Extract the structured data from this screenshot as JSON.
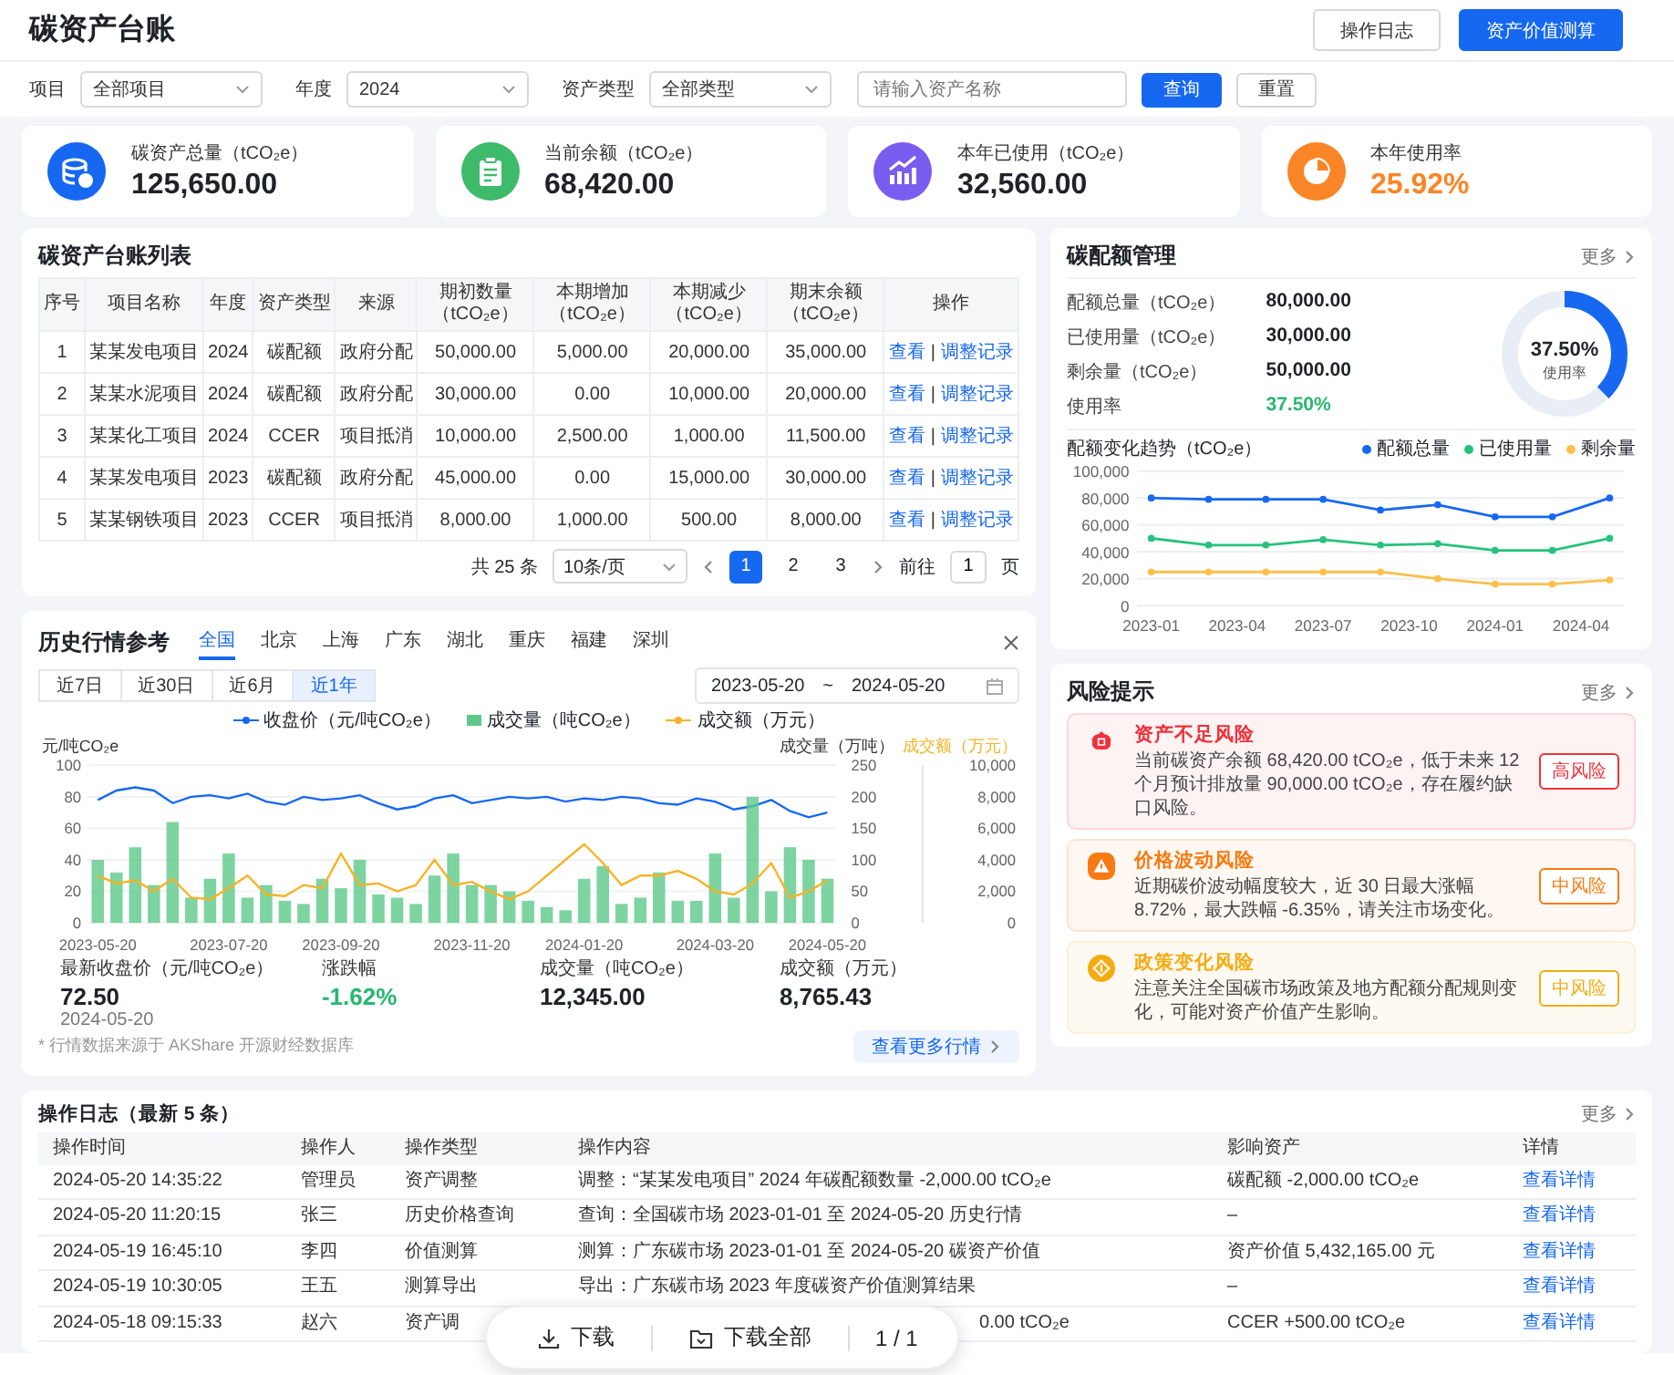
{
  "header": {
    "title": "碳资产台账",
    "buttons": [
      {
        "label": "操作日志",
        "primary": false
      },
      {
        "label": "资产价值测算",
        "primary": true
      }
    ]
  },
  "filters": {
    "selects": [
      {
        "label": "项目",
        "value": "全部项目"
      },
      {
        "label": "年度",
        "value": "2024"
      },
      {
        "label": "资产类型",
        "value": "全部类型"
      }
    ],
    "search": {
      "placeholder": "请输入资产名称"
    },
    "buttons": [
      {
        "label": "查询",
        "primary": true
      },
      {
        "label": "重置",
        "primary": false
      }
    ]
  },
  "kpis": [
    {
      "kind": "database",
      "label": "碳资产总量（tCO₂e）",
      "value": "125,650.00",
      "color": "#1668f0",
      "highlight": false
    },
    {
      "kind": "clipboard",
      "label": "当前余额（tCO₂e）",
      "value": "68,420.00",
      "color": "#3dba6a",
      "highlight": false
    },
    {
      "kind": "trend",
      "label": "本年已使用（tCO₂e）",
      "value": "32,560.00",
      "color": "#7b5cf0",
      "highlight": false
    },
    {
      "kind": "pie",
      "label": "本年使用率",
      "value": "25.92%",
      "color": "#fa8526",
      "highlight": true
    }
  ],
  "ledger": {
    "title": "碳资产台账列表",
    "columns": [
      "序号",
      "项目名称",
      "年度",
      "资产类型",
      "来源",
      "期初数量（tCO₂e）",
      "本期增加（tCO₂e）",
      "本期减少（tCO₂e）",
      "期末余额（tCO₂e）",
      "操作"
    ],
    "rows": [
      {
        "cells": [
          "1",
          "某某发电项目",
          "2024",
          "碳配额",
          "政府分配",
          "50,000.00",
          "5,000.00",
          "20,000.00",
          "35,000.00"
        ],
        "actions": [
          "查看",
          "调整记录"
        ]
      },
      {
        "cells": [
          "2",
          "某某水泥项目",
          "2024",
          "碳配额",
          "政府分配",
          "30,000.00",
          "0.00",
          "10,000.00",
          "20,000.00"
        ],
        "actions": [
          "查看",
          "调整记录"
        ]
      },
      {
        "cells": [
          "3",
          "某某化工项目",
          "2024",
          "CCER",
          "项目抵消",
          "10,000.00",
          "2,500.00",
          "1,000.00",
          "11,500.00"
        ],
        "actions": [
          "查看",
          "调整记录"
        ]
      },
      {
        "cells": [
          "4",
          "某某发电项目",
          "2023",
          "碳配额",
          "政府分配",
          "45,000.00",
          "0.00",
          "15,000.00",
          "30,000.00"
        ],
        "actions": [
          "查看",
          "调整记录"
        ]
      },
      {
        "cells": [
          "5",
          "某某钢铁项目",
          "2023",
          "CCER",
          "项目抵消",
          "8,000.00",
          "1,000.00",
          "500.00",
          "8,000.00"
        ],
        "actions": [
          "查看",
          "调整记录"
        ]
      }
    ],
    "action_separator": "|",
    "pagination": {
      "total": "共 25 条",
      "page_size": "10条/页",
      "pages": [
        {
          "label": "1",
          "selected": true
        },
        {
          "label": "2",
          "selected": false
        },
        {
          "label": "3",
          "selected": false
        }
      ],
      "goto_label": "前往",
      "goto_value": "1",
      "goto_suffix": "页"
    }
  },
  "quota": {
    "title": "碳配额管理",
    "more": "更多",
    "stats": [
      {
        "kind": "amount",
        "label": "配额总量（tCO₂e）",
        "value": "80,000.00"
      },
      {
        "kind": "amount",
        "label": "已使用量（tCO₂e）",
        "value": "30,000.00"
      },
      {
        "kind": "amount",
        "label": "剩余量（tCO₂e）",
        "value": "50,000.00"
      },
      {
        "kind": "rate",
        "label": "使用率",
        "value": "37.50%"
      }
    ],
    "donut": {
      "level": 0.375,
      "value": "37.50%",
      "caption": "使用率"
    },
    "trend": {
      "title": "配额变化趋势（tCO₂e）",
      "chart_data": {
        "type": "line",
        "grid": true,
        "categories": [
          "2023-01",
          null,
          null,
          "2023-04",
          null,
          null,
          "2023-07",
          null,
          null,
          "2023-10",
          null,
          null,
          "2024-01",
          null,
          null,
          "2024-04",
          null
        ],
        "ylim": [
          0,
          100000
        ],
        "yticks": [
          {
            "value": 0,
            "label": "0"
          },
          {
            "value": 20000,
            "label": "20,000"
          },
          {
            "value": 40000,
            "label": "40,000"
          },
          {
            "value": 60000,
            "label": "60,000"
          },
          {
            "value": 80000,
            "label": "80,000"
          },
          {
            "value": 100000,
            "label": "100,000"
          }
        ],
        "series": [
          {
            "name": "配额总量",
            "color": "#1668f0",
            "marker": "circle",
            "values": [
              80000,
              null,
              79000,
              null,
              79000,
              null,
              79000,
              null,
              71000,
              null,
              75000,
              null,
              66000,
              null,
              66000,
              null,
              80000
            ]
          },
          {
            "name": "已使用量",
            "color": "#27c27c",
            "marker": "circle",
            "values": [
              50000,
              null,
              45000,
              null,
              45000,
              null,
              49000,
              null,
              45000,
              null,
              46000,
              null,
              41000,
              null,
              41000,
              null,
              50000
            ]
          },
          {
            "name": "剩余量",
            "color": "#fbbf4a",
            "marker": "circle",
            "values": [
              25000,
              null,
              25000,
              null,
              25000,
              null,
              25000,
              null,
              25000,
              null,
              20000,
              null,
              16000,
              null,
              16000,
              null,
              19000
            ]
          }
        ]
      }
    }
  },
  "history": {
    "title": "历史行情参考",
    "regions": [
      {
        "label": "全国",
        "selected": true
      },
      {
        "label": "北京",
        "selected": false
      },
      {
        "label": "上海",
        "selected": false
      },
      {
        "label": "广东",
        "selected": false
      },
      {
        "label": "湖北",
        "selected": false
      },
      {
        "label": "重庆",
        "selected": false
      },
      {
        "label": "福建",
        "selected": false
      },
      {
        "label": "深圳",
        "selected": false
      }
    ],
    "ranges": [
      {
        "label": "近7日",
        "selected": false
      },
      {
        "label": "近30日",
        "selected": false
      },
      {
        "label": "近6月",
        "selected": false
      },
      {
        "label": "近1年",
        "selected": true
      }
    ],
    "date_from": "2023-05-20",
    "date_sep": "~",
    "date_to": "2024-05-20",
    "chart_data": {
      "type": "bar",
      "grid": true,
      "ylabel": "元/吨CO₂e",
      "y2label": "成交量（万吨）",
      "y3label": "成交额（万元）",
      "ylim": [
        0,
        100
      ],
      "y2lim": [
        0,
        250
      ],
      "y3lim": [
        0,
        10000
      ],
      "categories": [
        "2023-05-20",
        null,
        null,
        null,
        null,
        null,
        null,
        "2023-07-20",
        null,
        null,
        null,
        null,
        null,
        "2023-09-20",
        null,
        null,
        null,
        null,
        null,
        null,
        "2023-11-20",
        null,
        null,
        null,
        null,
        null,
        "2024-01-20",
        null,
        null,
        null,
        null,
        null,
        null,
        "2024-03-20",
        null,
        null,
        null,
        null,
        null,
        "2024-05-20"
      ],
      "yticks": [
        0,
        20,
        40,
        60,
        80,
        100
      ],
      "y2ticks": [
        0,
        50,
        100,
        150,
        200,
        250
      ],
      "y3ticks": [
        {
          "value": 0,
          "label": "0"
        },
        {
          "value": 2000,
          "label": "2,000"
        },
        {
          "value": 4000,
          "label": "4,000"
        },
        {
          "value": 6000,
          "label": "6,000"
        },
        {
          "value": 8000,
          "label": "8,000"
        },
        {
          "value": 10000,
          "label": "10,000"
        }
      ],
      "series": [
        {
          "name": "收盘价（元/吨CO₂e）",
          "type": "line",
          "axis": "y",
          "color": "#1668f0",
          "values": [
            78,
            84,
            86,
            84,
            76,
            80,
            81,
            79,
            82,
            77,
            75,
            80,
            78,
            79,
            81,
            76,
            72,
            74,
            79,
            81,
            76,
            78,
            80,
            79,
            80,
            77,
            79,
            78,
            80,
            79,
            76,
            75,
            79,
            77,
            72,
            74,
            78,
            71,
            67,
            70
          ]
        },
        {
          "name": "成交量（吨CO₂e）",
          "axis": "y2",
          "color": "#5cc98a",
          "values": [
            100,
            80,
            120,
            60,
            160,
            40,
            70,
            110,
            40,
            60,
            35,
            30,
            70,
            55,
            100,
            45,
            40,
            30,
            75,
            110,
            60,
            60,
            50,
            35,
            25,
            20,
            70,
            90,
            30,
            40,
            80,
            35,
            35,
            110,
            40,
            200,
            50,
            120,
            100,
            70
          ]
        },
        {
          "name": "成交额（万元）",
          "type": "line",
          "axis": "y3",
          "color": "#f5b324",
          "values": [
            3000,
            2500,
            2700,
            2000,
            2800,
            1600,
            1500,
            2200,
            3000,
            1800,
            1700,
            2400,
            2200,
            4400,
            2400,
            2500,
            2000,
            2400,
            4000,
            2400,
            2600,
            2000,
            1500,
            2000,
            3000,
            4000,
            5000,
            3800,
            2400,
            3000,
            3000,
            3300,
            2800,
            2000,
            1800,
            2500,
            3800,
            1600,
            2000,
            2700
          ]
        }
      ]
    },
    "stats": [
      {
        "kind": "price",
        "label": "最新收盘价（元/吨CO₂e）",
        "value": "72.50",
        "date": "2024-05-20"
      },
      {
        "kind": "change",
        "label": "涨跌幅",
        "value": "-1.62%"
      },
      {
        "kind": "plain",
        "label": "成交量（吨CO₂e）",
        "value": "12,345.00"
      },
      {
        "kind": "plain",
        "label": "成交额（万元）",
        "value": "8,765.43"
      }
    ],
    "footnote": "* 行情数据来源于 AKShare 开源财经数据库",
    "more_button": "查看更多行情"
  },
  "risks": {
    "title": "风险提示",
    "more": "更多",
    "items": [
      {
        "kind": "asset",
        "title": "资产不足风险",
        "text": "当前碳资产余额 68,420.00 tCO₂e，低于未来 12 个月预计排放量 90,000.00 tCO₂e，存在履约缺口风险。",
        "badge": "高风险",
        "color": "#f0313a"
      },
      {
        "kind": "price",
        "title": "价格波动风险",
        "text": "近期碳价波动幅度较大，近 30 日最大涨幅 8.72%，最大跌幅 -6.35%，请关注市场变化。",
        "badge": "中风险",
        "color": "#f77b12"
      },
      {
        "kind": "policy",
        "title": "政策变化风险",
        "text": "注意关注全国碳市场政策及地方配额分配规则变化，可能对资产价值产生影响。",
        "badge": "中风险",
        "color": "#f5ac12"
      }
    ]
  },
  "log": {
    "title": "操作日志（最新 5 条）",
    "more": "更多",
    "columns": [
      "操作时间",
      "操作人",
      "操作类型",
      "操作内容",
      "影响资产",
      "详情"
    ],
    "rows": [
      {
        "cells": [
          "2024-05-20 14:35:22",
          "管理员",
          "资产调整",
          "调整：“某某发电项目” 2024 年碳配额数量 -2,000.00 tCO₂e",
          "碳配额 -2,000.00 tCO₂e"
        ],
        "link": "查看详情",
        "partially_hidden": false
      },
      {
        "cells": [
          "2024-05-20 11:20:15",
          "张三",
          "历史价格查询",
          "查询：全国碳市场 2023-01-01 至 2024-05-20 历史行情",
          "–"
        ],
        "link": "查看详情",
        "partially_hidden": false
      },
      {
        "cells": [
          "2024-05-19 16:45:10",
          "李四",
          "价值测算",
          "测算：广东碳市场 2023-01-01 至 2024-05-20 碳资产价值",
          "资产价值 5,432,165.00 元"
        ],
        "link": "查看详情",
        "partially_hidden": false
      },
      {
        "cells": [
          "2024-05-19 10:30:05",
          "王五",
          "测算导出",
          "导出：广东碳市场 2023 年度碳资产价值测算结果",
          "–"
        ],
        "link": "查看详情",
        "partially_hidden": false
      },
      {
        "cells": [
          "2024-05-18 09:15:33",
          "赵六",
          "资产调",
          "0.00 tCO₂e",
          "CCER +500.00 tCO₂e"
        ],
        "link": "查看详情",
        "partially_hidden": true
      }
    ]
  },
  "viewer_toolbar": {
    "buttons": [
      {
        "kind": "download",
        "label": "下载"
      },
      {
        "kind": "download_all",
        "label": "下载全部"
      }
    ],
    "page": "1 / 1"
  }
}
